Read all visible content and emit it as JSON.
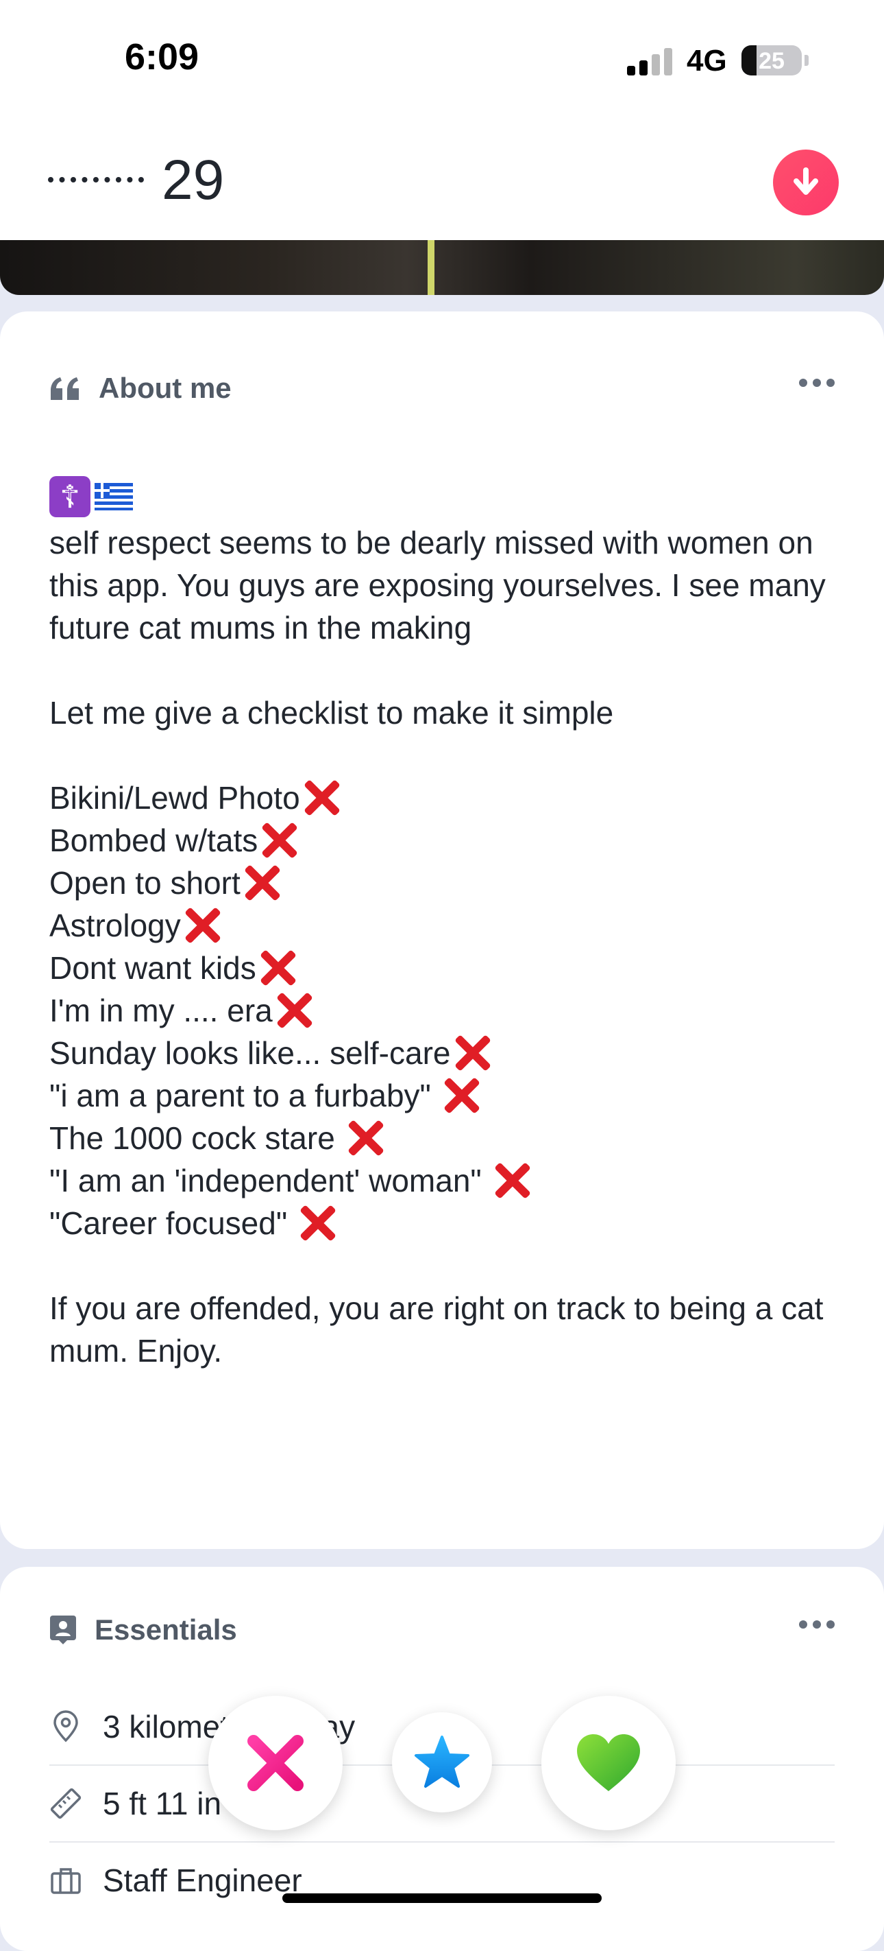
{
  "status_bar": {
    "time": "6:09",
    "network": "4G",
    "battery": "25",
    "battery_level": 0.25
  },
  "header": {
    "age": "29"
  },
  "about": {
    "title": "About me",
    "bio": [
      "self respect seems to be dearly missed with women on this app. You guys are exposing yourselves. I see many future cat mums in the making",
      "Let me give a checklist to make it simple"
    ],
    "checklist": [
      "Bikini/Lewd Photo",
      "Bombed w/tats",
      "Open to short",
      "Astrology",
      "Dont want kids",
      "I'm in my .... era",
      "Sunday looks like... self-care",
      "\"i am a parent to a furbaby\" ",
      "The 1000 cock stare ",
      "\"I am an 'independent' woman\" ",
      "\"Career focused\" "
    ],
    "closing": "If you are offended, you are right on track to being a cat mum. Enjoy."
  },
  "essentials": {
    "title": "Essentials",
    "distance": "3 kilometres away",
    "height": "5 ft 11 in",
    "job": "Staff Engineer"
  },
  "colors": {
    "accent": "#fd3a6b",
    "nope": "#f21e8d",
    "super_like": "#1a9cf0",
    "like": "#5cc62d",
    "check_x": "#e01e26"
  },
  "icons": [
    "chevron-down-icon",
    "quote-icon",
    "more-icon",
    "id-card-icon",
    "location-pin-icon",
    "ruler-icon",
    "briefcase-icon",
    "nope-x-icon",
    "star-icon",
    "heart-icon"
  ]
}
